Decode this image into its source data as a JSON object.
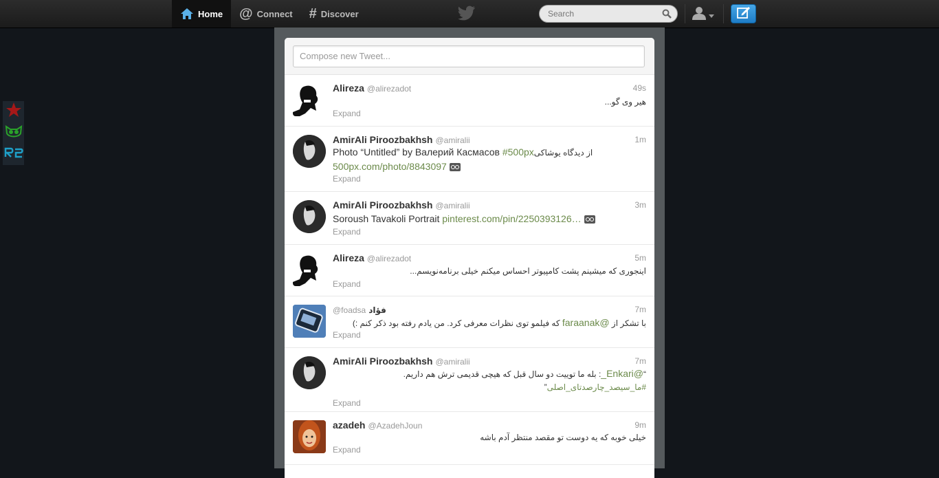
{
  "nav": {
    "home": "Home",
    "connect": "Connect",
    "discover": "Discover"
  },
  "search": {
    "placeholder": "Search"
  },
  "compose": {
    "placeholder": "Compose new Tweet..."
  },
  "colors": {
    "link": "#6b8a4a",
    "accent": "#2f8ad8",
    "topbar": "#222222"
  },
  "dock": [
    "star-icon",
    "owl-icon",
    "logo-icon"
  ],
  "tweets": [
    {
      "name": "Alireza",
      "handle": "@alirezadot",
      "time": "49s",
      "text": "هیر وی گو...",
      "expand": "Expand"
    },
    {
      "name": "AmirAli Piroozbakhsh",
      "handle": "@amiralii",
      "time": "1m",
      "text_pre": "Photo “Untitled” by Валерий Касмасов ",
      "hashtag": "#500px",
      "text_rtl": " از دیدگاه یوشاکی",
      "link": "500px.com/photo/8843097",
      "expand": "Expand"
    },
    {
      "name": "AmirAli Piroozbakhsh",
      "handle": "@amiralii",
      "time": "3m",
      "text_pre": "Soroush Tavakoli Portrait ",
      "link": "pinterest.com/pin/2250393126…",
      "expand": "Expand"
    },
    {
      "name": "Alireza",
      "handle": "@alirezadot",
      "time": "5m",
      "text": "اینجوری که میشینم پشت کامپیوتر احساس میکنم خیلی برنامه‌نویسم...",
      "expand": "Expand"
    },
    {
      "name": "فؤاد",
      "handle": "@foadsa",
      "time": "7m",
      "text_a": "با تشکر از ",
      "mention": "@faraanak",
      "text_b": " که فیلمو توی نظرات معرفی کرد. من یادم رفته بود ذکر کنم :)",
      "expand": "Expand"
    },
    {
      "name": "AmirAli Piroozbakhsh",
      "handle": "@amiralii",
      "time": "7m",
      "line1_mention": "@Enkari_",
      "line1": ": بله ما توییت دو سال قبل که هیچی قدیمی ترش هم داریم.",
      "line2": "#ما_سیصد_چارصدتای_اصلی",
      "expand": "Expand"
    },
    {
      "name": "azadeh",
      "handle": "@AzadehJoun",
      "time": "9m",
      "text": "خیلی خوبه که یه دوست تو مقصد منتظر آدم باشه",
      "expand": "Expand"
    }
  ]
}
